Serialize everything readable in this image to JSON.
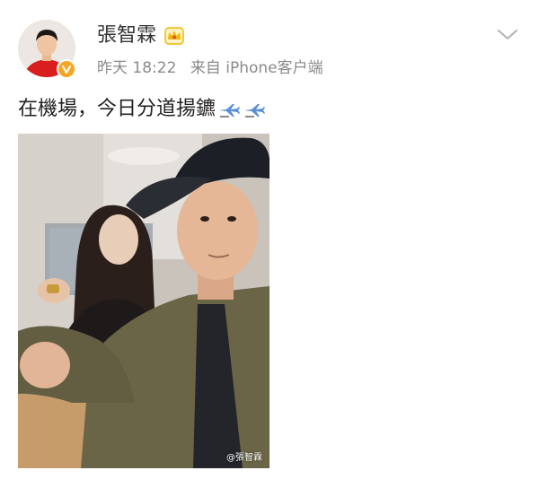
{
  "post": {
    "username": "張智霖",
    "time": "昨天 18:22",
    "source": "来自 iPhone客户端",
    "text": "在機場，今日分道揚鑣",
    "watermark": "@張智霖"
  },
  "icons": {
    "badge": "verified-badge-icon",
    "crown": "vip-crown-icon",
    "dropdown": "chevron-down-icon",
    "emoji": "airplane-icon"
  },
  "colors": {
    "text": "#222222",
    "meta": "#8a8a8a",
    "badge": "#f5a623",
    "crown": "#f2b705"
  }
}
